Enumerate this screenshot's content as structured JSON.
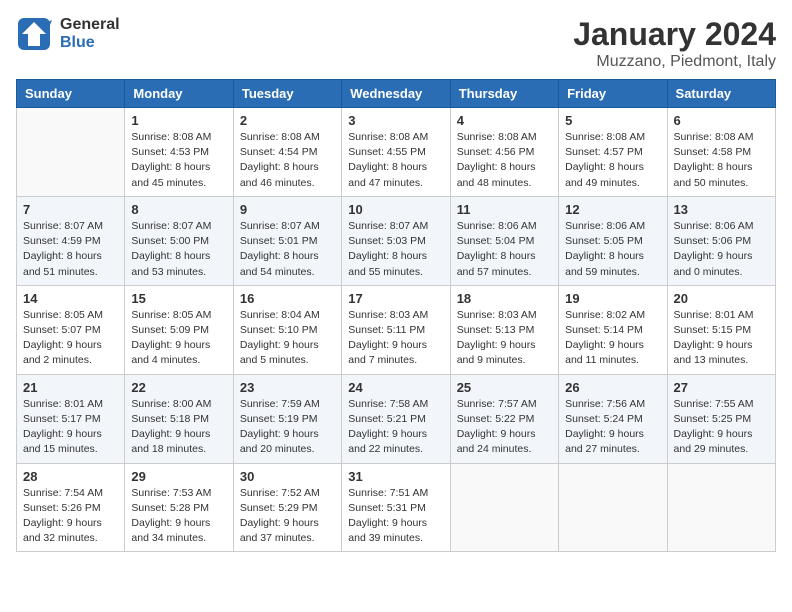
{
  "header": {
    "logo_general": "General",
    "logo_blue": "Blue",
    "month_title": "January 2024",
    "location": "Muzzano, Piedmont, Italy"
  },
  "weekdays": [
    "Sunday",
    "Monday",
    "Tuesday",
    "Wednesday",
    "Thursday",
    "Friday",
    "Saturday"
  ],
  "weeks": [
    [
      {
        "day": "",
        "sunrise": "",
        "sunset": "",
        "daylight": ""
      },
      {
        "day": "1",
        "sunrise": "Sunrise: 8:08 AM",
        "sunset": "Sunset: 4:53 PM",
        "daylight": "Daylight: 8 hours and 45 minutes."
      },
      {
        "day": "2",
        "sunrise": "Sunrise: 8:08 AM",
        "sunset": "Sunset: 4:54 PM",
        "daylight": "Daylight: 8 hours and 46 minutes."
      },
      {
        "day": "3",
        "sunrise": "Sunrise: 8:08 AM",
        "sunset": "Sunset: 4:55 PM",
        "daylight": "Daylight: 8 hours and 47 minutes."
      },
      {
        "day": "4",
        "sunrise": "Sunrise: 8:08 AM",
        "sunset": "Sunset: 4:56 PM",
        "daylight": "Daylight: 8 hours and 48 minutes."
      },
      {
        "day": "5",
        "sunrise": "Sunrise: 8:08 AM",
        "sunset": "Sunset: 4:57 PM",
        "daylight": "Daylight: 8 hours and 49 minutes."
      },
      {
        "day": "6",
        "sunrise": "Sunrise: 8:08 AM",
        "sunset": "Sunset: 4:58 PM",
        "daylight": "Daylight: 8 hours and 50 minutes."
      }
    ],
    [
      {
        "day": "7",
        "sunrise": "Sunrise: 8:07 AM",
        "sunset": "Sunset: 4:59 PM",
        "daylight": "Daylight: 8 hours and 51 minutes."
      },
      {
        "day": "8",
        "sunrise": "Sunrise: 8:07 AM",
        "sunset": "Sunset: 5:00 PM",
        "daylight": "Daylight: 8 hours and 53 minutes."
      },
      {
        "day": "9",
        "sunrise": "Sunrise: 8:07 AM",
        "sunset": "Sunset: 5:01 PM",
        "daylight": "Daylight: 8 hours and 54 minutes."
      },
      {
        "day": "10",
        "sunrise": "Sunrise: 8:07 AM",
        "sunset": "Sunset: 5:03 PM",
        "daylight": "Daylight: 8 hours and 55 minutes."
      },
      {
        "day": "11",
        "sunrise": "Sunrise: 8:06 AM",
        "sunset": "Sunset: 5:04 PM",
        "daylight": "Daylight: 8 hours and 57 minutes."
      },
      {
        "day": "12",
        "sunrise": "Sunrise: 8:06 AM",
        "sunset": "Sunset: 5:05 PM",
        "daylight": "Daylight: 8 hours and 59 minutes."
      },
      {
        "day": "13",
        "sunrise": "Sunrise: 8:06 AM",
        "sunset": "Sunset: 5:06 PM",
        "daylight": "Daylight: 9 hours and 0 minutes."
      }
    ],
    [
      {
        "day": "14",
        "sunrise": "Sunrise: 8:05 AM",
        "sunset": "Sunset: 5:07 PM",
        "daylight": "Daylight: 9 hours and 2 minutes."
      },
      {
        "day": "15",
        "sunrise": "Sunrise: 8:05 AM",
        "sunset": "Sunset: 5:09 PM",
        "daylight": "Daylight: 9 hours and 4 minutes."
      },
      {
        "day": "16",
        "sunrise": "Sunrise: 8:04 AM",
        "sunset": "Sunset: 5:10 PM",
        "daylight": "Daylight: 9 hours and 5 minutes."
      },
      {
        "day": "17",
        "sunrise": "Sunrise: 8:03 AM",
        "sunset": "Sunset: 5:11 PM",
        "daylight": "Daylight: 9 hours and 7 minutes."
      },
      {
        "day": "18",
        "sunrise": "Sunrise: 8:03 AM",
        "sunset": "Sunset: 5:13 PM",
        "daylight": "Daylight: 9 hours and 9 minutes."
      },
      {
        "day": "19",
        "sunrise": "Sunrise: 8:02 AM",
        "sunset": "Sunset: 5:14 PM",
        "daylight": "Daylight: 9 hours and 11 minutes."
      },
      {
        "day": "20",
        "sunrise": "Sunrise: 8:01 AM",
        "sunset": "Sunset: 5:15 PM",
        "daylight": "Daylight: 9 hours and 13 minutes."
      }
    ],
    [
      {
        "day": "21",
        "sunrise": "Sunrise: 8:01 AM",
        "sunset": "Sunset: 5:17 PM",
        "daylight": "Daylight: 9 hours and 15 minutes."
      },
      {
        "day": "22",
        "sunrise": "Sunrise: 8:00 AM",
        "sunset": "Sunset: 5:18 PM",
        "daylight": "Daylight: 9 hours and 18 minutes."
      },
      {
        "day": "23",
        "sunrise": "Sunrise: 7:59 AM",
        "sunset": "Sunset: 5:19 PM",
        "daylight": "Daylight: 9 hours and 20 minutes."
      },
      {
        "day": "24",
        "sunrise": "Sunrise: 7:58 AM",
        "sunset": "Sunset: 5:21 PM",
        "daylight": "Daylight: 9 hours and 22 minutes."
      },
      {
        "day": "25",
        "sunrise": "Sunrise: 7:57 AM",
        "sunset": "Sunset: 5:22 PM",
        "daylight": "Daylight: 9 hours and 24 minutes."
      },
      {
        "day": "26",
        "sunrise": "Sunrise: 7:56 AM",
        "sunset": "Sunset: 5:24 PM",
        "daylight": "Daylight: 9 hours and 27 minutes."
      },
      {
        "day": "27",
        "sunrise": "Sunrise: 7:55 AM",
        "sunset": "Sunset: 5:25 PM",
        "daylight": "Daylight: 9 hours and 29 minutes."
      }
    ],
    [
      {
        "day": "28",
        "sunrise": "Sunrise: 7:54 AM",
        "sunset": "Sunset: 5:26 PM",
        "daylight": "Daylight: 9 hours and 32 minutes."
      },
      {
        "day": "29",
        "sunrise": "Sunrise: 7:53 AM",
        "sunset": "Sunset: 5:28 PM",
        "daylight": "Daylight: 9 hours and 34 minutes."
      },
      {
        "day": "30",
        "sunrise": "Sunrise: 7:52 AM",
        "sunset": "Sunset: 5:29 PM",
        "daylight": "Daylight: 9 hours and 37 minutes."
      },
      {
        "day": "31",
        "sunrise": "Sunrise: 7:51 AM",
        "sunset": "Sunset: 5:31 PM",
        "daylight": "Daylight: 9 hours and 39 minutes."
      },
      {
        "day": "",
        "sunrise": "",
        "sunset": "",
        "daylight": ""
      },
      {
        "day": "",
        "sunrise": "",
        "sunset": "",
        "daylight": ""
      },
      {
        "day": "",
        "sunrise": "",
        "sunset": "",
        "daylight": ""
      }
    ]
  ]
}
